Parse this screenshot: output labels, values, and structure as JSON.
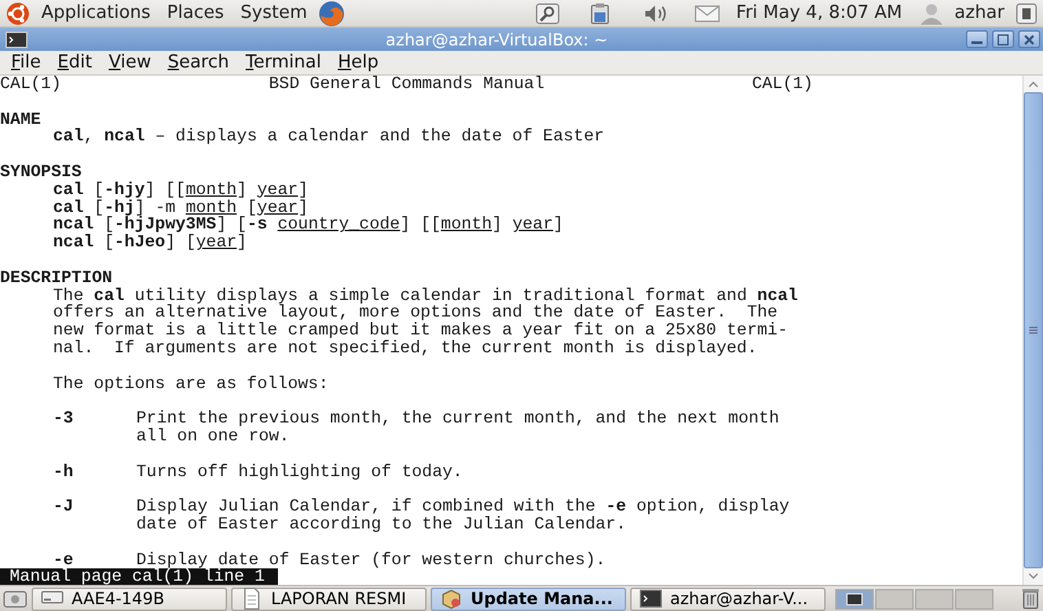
{
  "top_panel": {
    "menus": [
      "Applications",
      "Places",
      "System"
    ],
    "clock": "Fri May 4,  8:07 AM",
    "user": "azhar"
  },
  "window": {
    "title": "azhar@azhar-VirtualBox: ~"
  },
  "menu_bar": [
    "File",
    "Edit",
    "View",
    "Search",
    "Terminal",
    "Help"
  ],
  "man_page": {
    "header": {
      "left": "CAL(1)",
      "center": "BSD General Commands Manual",
      "right": "CAL(1)"
    },
    "lines": [
      {
        "kind": "heading",
        "gap_before": true,
        "segments": [
          {
            "text": "NAME",
            "underlined": false
          }
        ]
      },
      {
        "kind": "body",
        "gap_before": false,
        "segments": [
          {
            "text": "**cal**, **ncal** – displays a calendar and the date of Easter",
            "underlined": false
          }
        ]
      },
      {
        "kind": "heading",
        "gap_before": true,
        "segments": [
          {
            "text": "SYNOPSIS",
            "underlined": false
          }
        ]
      },
      {
        "kind": "body",
        "gap_before": false,
        "segments": [
          {
            "text": "**cal** [**-hjy**] [[",
            "underlined": false
          },
          {
            "text": "month",
            "underlined": true
          },
          {
            "text": "] ",
            "underlined": false
          },
          {
            "text": "year",
            "underlined": true
          },
          {
            "text": "]",
            "underlined": false
          }
        ]
      },
      {
        "kind": "body",
        "gap_before": false,
        "segments": [
          {
            "text": "**cal** [**-hj**] -m ",
            "underlined": false
          },
          {
            "text": "month",
            "underlined": true
          },
          {
            "text": " [",
            "underlined": false
          },
          {
            "text": "year",
            "underlined": true
          },
          {
            "text": "]",
            "underlined": false
          }
        ]
      },
      {
        "kind": "body",
        "gap_before": false,
        "segments": [
          {
            "text": "**ncal** [**-hjJpwy3MS**] [**-s** ",
            "underlined": false
          },
          {
            "text": "country_code",
            "underlined": true
          },
          {
            "text": "] [[",
            "underlined": false
          },
          {
            "text": "month",
            "underlined": true
          },
          {
            "text": "] ",
            "underlined": false
          },
          {
            "text": "year",
            "underlined": true
          },
          {
            "text": "]",
            "underlined": false
          }
        ]
      },
      {
        "kind": "body",
        "gap_before": false,
        "segments": [
          {
            "text": "**ncal** [**-hJeo**] [",
            "underlined": false
          },
          {
            "text": "year",
            "underlined": true
          },
          {
            "text": "]",
            "underlined": false
          }
        ]
      },
      {
        "kind": "heading",
        "gap_before": true,
        "segments": [
          {
            "text": "DESCRIPTION",
            "underlined": false
          }
        ]
      },
      {
        "kind": "body",
        "gap_before": false,
        "segments": [
          {
            "text": "The **cal** utility displays a simple calendar in traditional format and **ncal**",
            "underlined": false
          }
        ]
      },
      {
        "kind": "body",
        "gap_before": false,
        "segments": [
          {
            "text": "offers an alternative layout, more options and the date of Easter.  The",
            "underlined": false
          }
        ]
      },
      {
        "kind": "body",
        "gap_before": false,
        "segments": [
          {
            "text": "new format is a little cramped but it makes a year fit on a 25x80 termi-",
            "underlined": false
          }
        ]
      },
      {
        "kind": "body",
        "gap_before": false,
        "segments": [
          {
            "text": "nal.  If arguments are not specified, the current month is displayed.",
            "underlined": false
          }
        ]
      },
      {
        "kind": "body",
        "gap_before": true,
        "segments": [
          {
            "text": "The options are as follows:",
            "underlined": false
          }
        ]
      },
      {
        "kind": "option",
        "gap_before": true,
        "flag": "-3",
        "segments": [
          {
            "text": "Print the previous month, the current month, and the next month",
            "underlined": false
          }
        ]
      },
      {
        "kind": "continuation",
        "gap_before": false,
        "segments": [
          {
            "text": "all on one row.",
            "underlined": false
          }
        ]
      },
      {
        "kind": "option",
        "gap_before": true,
        "flag": "-h",
        "segments": [
          {
            "text": "Turns off highlighting of today.",
            "underlined": false
          }
        ]
      },
      {
        "kind": "option",
        "gap_before": true,
        "flag": "-J",
        "segments": [
          {
            "text": "Display Julian Calendar, if combined with the **-e** option, display",
            "underlined": false
          }
        ]
      },
      {
        "kind": "continuation",
        "gap_before": false,
        "segments": [
          {
            "text": "date of Easter according to the Julian Calendar.",
            "underlined": false
          }
        ]
      },
      {
        "kind": "option",
        "gap_before": true,
        "flag": "-e",
        "segments": [
          {
            "text": "Display date of Easter (for western churches).",
            "underlined": false
          }
        ]
      }
    ],
    "status_line": "Manual page cal(1) line 1"
  },
  "taskbar": {
    "tasks": [
      {
        "label": "AAE4-149B",
        "kind": "drive",
        "selected": false
      },
      {
        "label": "LAPORAN RESMI",
        "kind": "document",
        "selected": false
      },
      {
        "label": "Update Mana...",
        "kind": "package",
        "selected": true
      },
      {
        "label": "azhar@azhar-V...",
        "kind": "terminal",
        "selected": false
      }
    ]
  }
}
